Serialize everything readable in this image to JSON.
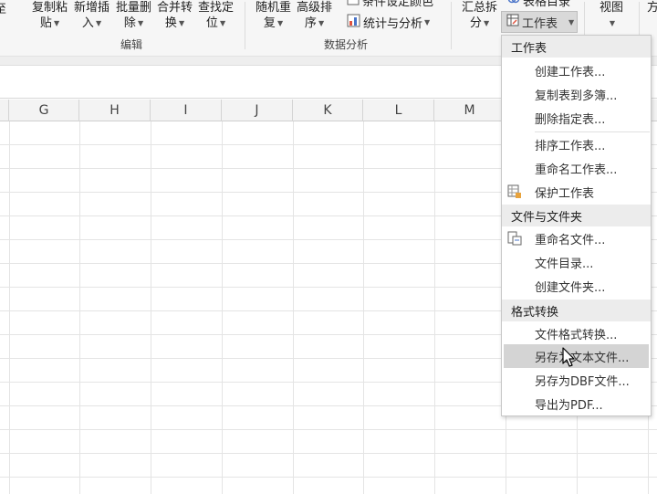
{
  "ribbon": {
    "buttons": [
      {
        "line1": "复制粘",
        "line2": "贴"
      },
      {
        "line1": "新增插",
        "line2": "入"
      },
      {
        "line1": "批量删",
        "line2": "除"
      },
      {
        "line1": "合并转",
        "line2": "换"
      },
      {
        "line1": "查找定",
        "line2": "位"
      },
      {
        "line1": "随机重",
        "line2": "复"
      },
      {
        "line1": "高级排",
        "line2": "序"
      },
      {
        "line1": "汇总拆",
        "line2": "分"
      },
      {
        "line1": "视图",
        "line2": ""
      }
    ],
    "side_items": {
      "conditional_top": "条件设定颜色",
      "stats_analysis": "统计与分析",
      "table_directory": "表格目录",
      "worksheet": "工作表",
      "edge_char": "方"
    },
    "groups": {
      "edit": "编辑",
      "data_analysis": "数据分析"
    }
  },
  "columns": [
    "G",
    "H",
    "I",
    "J",
    "K",
    "L",
    "M"
  ],
  "menu": {
    "sections": [
      {
        "title": "工作表",
        "items": [
          "创建工作表...",
          "复制表到多簿...",
          "删除指定表...",
          "排序工作表...",
          "重命名工作表...",
          "保护工作表"
        ]
      },
      {
        "title": "文件与文件夹",
        "items": [
          "重命名文件...",
          "文件目录...",
          "创建文件夹..."
        ]
      },
      {
        "title": "格式转换",
        "items": [
          "文件格式转换...",
          "另存为文本文件...",
          "另存为DBF文件...",
          "导出为PDF..."
        ]
      }
    ],
    "highlighted_item": "另存为文本文件..."
  },
  "colors": {
    "ribbon_bg": "#f6f6f6",
    "menu_highlight": "#d4d4d4",
    "section_bg": "#ececec",
    "grid_line": "#e4e4e4"
  }
}
